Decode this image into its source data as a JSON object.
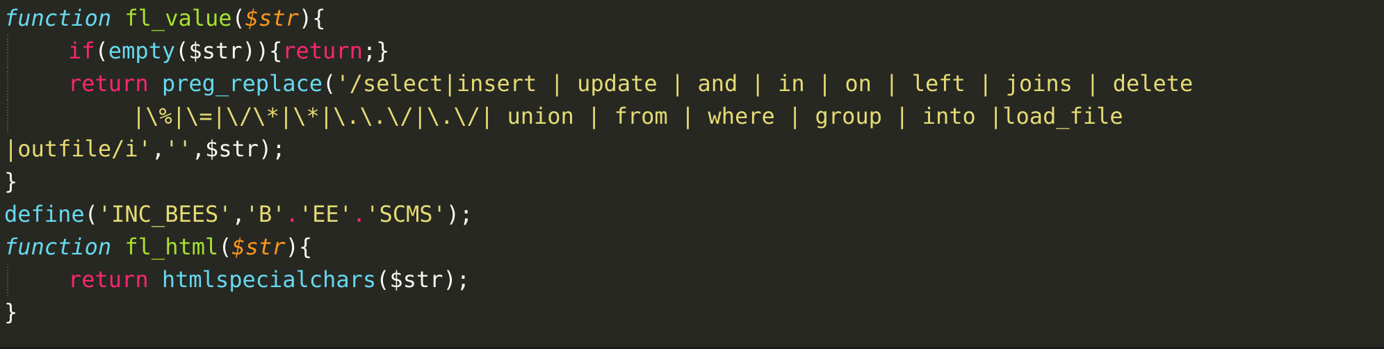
{
  "code": {
    "l1": {
      "kw": "function",
      "name": "fl_value",
      "open": "(",
      "param": "$str",
      "close": "){"
    },
    "l2": {
      "kw": "if",
      "p1": "(",
      "fn": "empty",
      "args": "($str)){",
      "ret": "return",
      "end": ";}"
    },
    "l3": {
      "ret": "return",
      "fn": "preg_replace",
      "open": "(",
      "str": "'/select|insert | update | and | in | on | left | joins | delete"
    },
    "l4": {
      "str": "|\\%|\\=|\\/\\*|\\*|\\.\\.\\/|\\.\\/| union | from | where | group | into |load_file"
    },
    "l5": {
      "str": "|outfile/i'",
      "sep": ",",
      "empty": "''",
      "tail": ",$str);"
    },
    "l6": {
      "brace": "}"
    },
    "l7": {
      "fn": "define",
      "open": "(",
      "s1": "'INC_BEES'",
      "c1": ",",
      "s2": "'B'",
      "d1": ".",
      "s3": "'EE'",
      "d2": ".",
      "s4": "'SCMS'",
      "end": ");"
    },
    "l8": {
      "kw": "function",
      "name": "fl_html",
      "open": "(",
      "param": "$str",
      "close": "){"
    },
    "l9": {
      "ret": "return",
      "fn": "htmlspecialchars",
      "args": "($str);"
    },
    "l10": {
      "brace": "}"
    }
  },
  "colors": {
    "background": "#272822",
    "keyword": "#f92672",
    "function_kw": "#66d9ef",
    "function_name": "#a6e22e",
    "parameter": "#fd971f",
    "string": "#e6db74",
    "plain": "#f8f8f2"
  }
}
